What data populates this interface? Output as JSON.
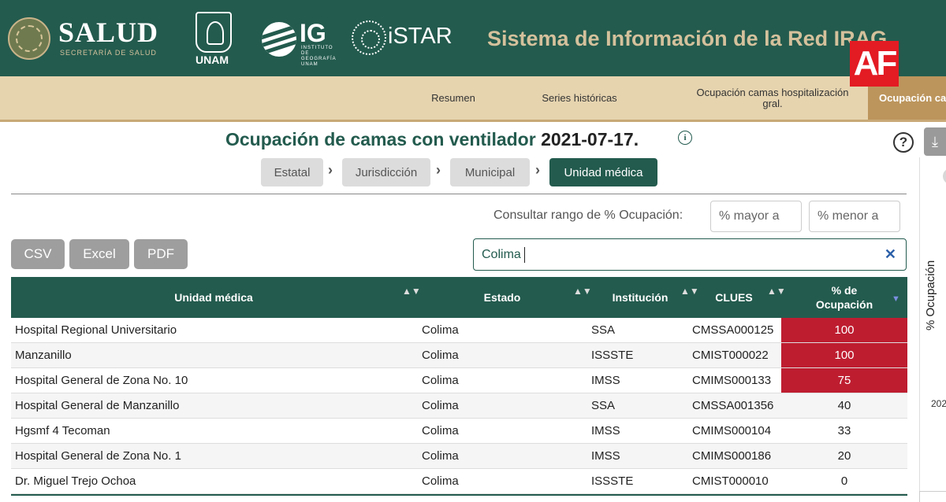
{
  "header": {
    "salud_title": "SALUD",
    "salud_subtitle": "SECRETARÍA DE SALUD",
    "unam_label": "UNAM",
    "ig_label": "IG",
    "ig_subtitle": "INSTITUTO DE GEOGRAFÍA UNAM",
    "istar_label": "iSTAR",
    "system_title": "Sistema de Información de la Red IRAG",
    "watermark": "AF",
    "colors": {
      "header_bg": "#235b4e",
      "accent_gold": "#d4c19c"
    }
  },
  "nav": {
    "items": [
      {
        "label": "Resumen"
      },
      {
        "label": "Series históricas"
      },
      {
        "label": "Ocupación camas hospitalización gral."
      },
      {
        "label": "Ocupación ca"
      }
    ]
  },
  "main": {
    "title_prefix": "Ocupación de camas con ventilador",
    "title_date": "2021-07-17.",
    "info_icon": "i",
    "help_icon": "?",
    "download_icon": "⤓",
    "breadcrumb": {
      "items": [
        {
          "label": "Estatal"
        },
        {
          "label": "Jurisdicción"
        },
        {
          "label": "Municipal"
        },
        {
          "label": "Unidad médica"
        }
      ],
      "separator": "›"
    },
    "range": {
      "label": "Consultar rango de % Ocupación:",
      "min_placeholder": "% mayor a",
      "max_placeholder": "% menor a"
    },
    "export": {
      "csv": "CSV",
      "excel": "Excel",
      "pdf": "PDF"
    },
    "search": {
      "value": "Colima",
      "clear_icon": "✕"
    }
  },
  "table": {
    "headers": {
      "unidad": "Unidad médica",
      "estado": "Estado",
      "institucion": "Institución",
      "clues": "CLUES",
      "ocupacion_line1": "% de",
      "ocupacion_line2": "Ocupación"
    },
    "sort_icon": "▲▼",
    "sort_desc_icon": "▼",
    "rows": [
      {
        "unidad": "Hospital Regional Universitario",
        "estado": "Colima",
        "institucion": "SSA",
        "clues": "CMSSA000125",
        "ocupacion": "100"
      },
      {
        "unidad": "Manzanillo",
        "estado": "Colima",
        "institucion": "ISSSTE",
        "clues": "CMIST000022",
        "ocupacion": "100"
      },
      {
        "unidad": "Hospital General de Zona No. 10",
        "estado": "Colima",
        "institucion": "IMSS",
        "clues": "CMIMS000133",
        "ocupacion": "75"
      },
      {
        "unidad": "Hospital General de Manzanillo",
        "estado": "Colima",
        "institucion": "SSA",
        "clues": "CMSSA001356",
        "ocupacion": "40"
      },
      {
        "unidad": "Hgsmf 4 Tecoman",
        "estado": "Colima",
        "institucion": "IMSS",
        "clues": "CMIMS000104",
        "ocupacion": "33"
      },
      {
        "unidad": "Hospital General de Zona No. 1",
        "estado": "Colima",
        "institucion": "IMSS",
        "clues": "CMIMS000186",
        "ocupacion": "20"
      },
      {
        "unidad": "Dr. Miguel Trejo Ochoa",
        "estado": "Colima",
        "institucion": "ISSSTE",
        "clues": "CMIST000010",
        "ocupacion": "0"
      }
    ],
    "high_occupancy_color": "#be1d30"
  },
  "side_panel": {
    "ylabel": "% Ocupación",
    "tick": "202"
  }
}
